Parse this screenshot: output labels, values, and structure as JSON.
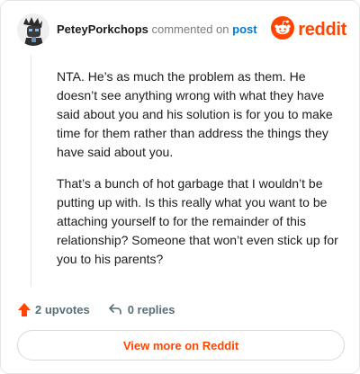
{
  "comment": {
    "username": "PeteyPorkchops",
    "commented_on_text": "commented on",
    "post_link_text": "post",
    "paragraphs": [
      "NTA. He’s as much the problem as them. He doesn’t see anything wrong with what they have said about you and his solution is for you to make time for them rather than address the things they have said about you.",
      "That’s a bunch of hot garbage that I wouldn’t be putting up with. Is this really what you want to be attaching yourself to for the remainder of this relationship? Someone that won’t even stick up for you to his parents?"
    ]
  },
  "brand": {
    "name": "reddit",
    "color": "#ff4500",
    "icon": "reddit-logo-icon"
  },
  "actions": {
    "upvotes_label": "2 upvotes",
    "replies_label": "0 replies",
    "upvote_icon": "upvote-arrow-icon",
    "reply_icon": "reply-arrow-icon",
    "upvote_color": "#ff4500"
  },
  "footer": {
    "view_more_label": "View more on Reddit"
  }
}
